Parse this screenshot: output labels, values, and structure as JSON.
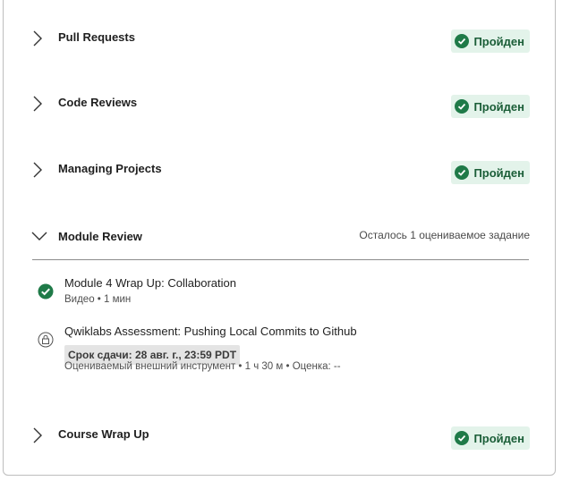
{
  "sections": {
    "pull_requests": {
      "title": "Pull Requests",
      "status": "Пройден"
    },
    "code_reviews": {
      "title": "Code Reviews",
      "status": "Пройден"
    },
    "managing_projects": {
      "title": "Managing Projects",
      "status": "Пройден"
    },
    "module_review": {
      "title": "Module Review",
      "remaining": "Осталось 1 оцениваемое задание",
      "items": [
        {
          "title": "Module 4 Wrap Up: Collaboration",
          "meta": "Видео • 1 мин",
          "icon": "check-circle-icon"
        },
        {
          "title": "Qwiklabs Assessment: Pushing Local Commits to Github",
          "due": "Срок сдачи: 28 авг. г., 23:59 PDT",
          "meta": "Оцениваемый внешний инструмент • 1 ч 30 м • Оценка: --",
          "icon": "lock-icon"
        }
      ]
    },
    "course_wrap_up": {
      "title": "Course Wrap Up",
      "status": "Пройден"
    }
  },
  "colors": {
    "success": "#1f7a48",
    "success_bg": "#e3f3ea",
    "divider": "#8c8c8c"
  }
}
